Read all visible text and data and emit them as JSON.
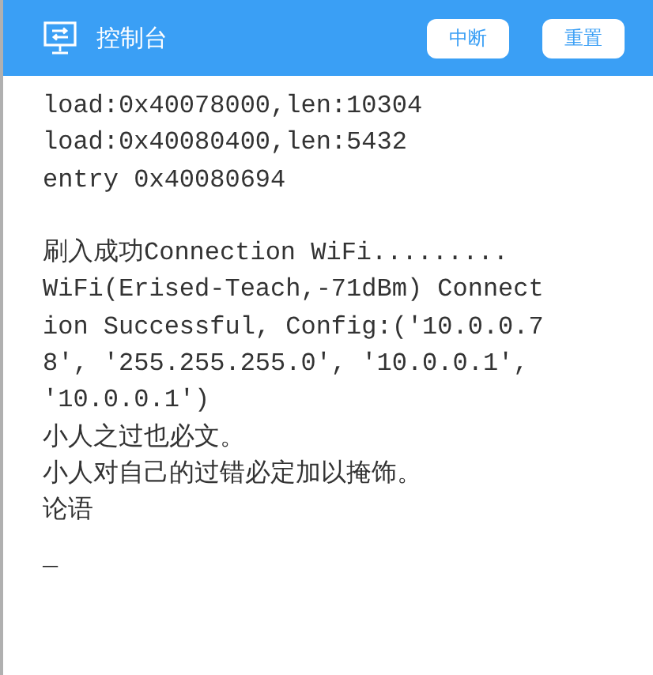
{
  "header": {
    "title": "控制台",
    "buttons": [
      "中断",
      "重置"
    ]
  },
  "console": {
    "blocks": [
      [
        "load:0x40078000,len:10304",
        "load:0x40080400,len:5432",
        "entry 0x40080694"
      ],
      [
        "刷入成功Connection WiFi.........",
        "WiFi(Erised-Teach,-71dBm) Connect",
        "ion Successful, Config:('10.0.0.7",
        "8', '255.255.255.0', '10.0.0.1',",
        "'10.0.0.1')",
        "小人之过也必文。",
        "小人对自己的过错必定加以掩饰。",
        "论语"
      ]
    ],
    "cursor": "_"
  }
}
